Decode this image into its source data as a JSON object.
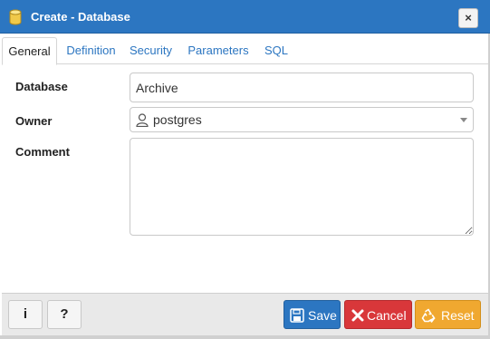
{
  "dialog": {
    "title": "Create - Database",
    "close_glyph": "×"
  },
  "tabs": [
    {
      "label": "General",
      "active": true
    },
    {
      "label": "Definition",
      "active": false
    },
    {
      "label": "Security",
      "active": false
    },
    {
      "label": "Parameters",
      "active": false
    },
    {
      "label": "SQL",
      "active": false
    }
  ],
  "form": {
    "database": {
      "label": "Database",
      "value": "Archive"
    },
    "owner": {
      "label": "Owner",
      "value": "postgres"
    },
    "comment": {
      "label": "Comment",
      "value": ""
    }
  },
  "footer": {
    "info_label": "i",
    "help_label": "?",
    "save_label": "Save",
    "cancel_label": "Cancel",
    "reset_label": "Reset"
  },
  "colors": {
    "titlebar": "#2c76c1",
    "save": "#2c76c1",
    "cancel": "#d9373a",
    "reset": "#f0a830"
  }
}
